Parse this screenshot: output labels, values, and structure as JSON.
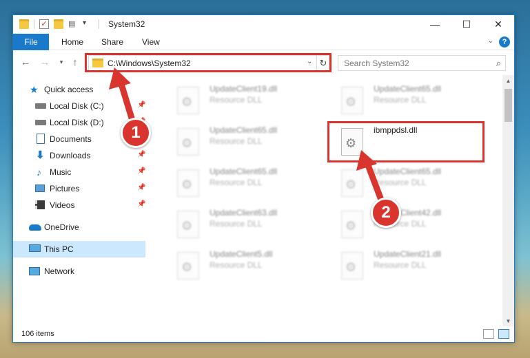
{
  "window": {
    "title": "System32",
    "controls": {
      "minimize": "—",
      "maximize": "☐",
      "close": "✕"
    }
  },
  "ribbon": {
    "file_tab": "File",
    "tabs": [
      "Home",
      "Share",
      "View"
    ],
    "help": "?"
  },
  "navigation": {
    "address": "C:\\Windows\\System32",
    "search_placeholder": "Search System32"
  },
  "sidebar": {
    "items": [
      {
        "label": "Quick access",
        "icon": "star-icon",
        "pinned": false
      },
      {
        "label": "Local Disk (C:)",
        "icon": "drive-icon",
        "pinned": true
      },
      {
        "label": "Local Disk (D:)",
        "icon": "drive-icon",
        "pinned": true
      },
      {
        "label": "Documents",
        "icon": "documents-icon",
        "pinned": true
      },
      {
        "label": "Downloads",
        "icon": "downloads-icon",
        "pinned": true
      },
      {
        "label": "Music",
        "icon": "music-icon",
        "pinned": true
      },
      {
        "label": "Pictures",
        "icon": "pictures-icon",
        "pinned": true
      },
      {
        "label": "Videos",
        "icon": "videos-icon",
        "pinned": true
      },
      {
        "label": "OneDrive",
        "icon": "onedrive-icon",
        "pinned": false
      },
      {
        "label": "This PC",
        "icon": "this-pc-icon",
        "pinned": false,
        "selected": true
      },
      {
        "label": "Network",
        "icon": "network-icon",
        "pinned": false
      }
    ]
  },
  "files": {
    "left_column": [
      {
        "name": "UpdateClient19.dll",
        "type": "Resource DLL"
      },
      {
        "name": "UpdateClient65.dll",
        "type": "Resource DLL"
      },
      {
        "name": "UpdateClient65.dll",
        "type": "Resource DLL"
      },
      {
        "name": "UpdateClient63.dll",
        "type": "Resource DLL"
      },
      {
        "name": "UpdateClient5.dll",
        "type": "Resource DLL"
      }
    ],
    "right_column": [
      {
        "name": "UpdateClient65.dll",
        "type": "Resource DLL"
      },
      {
        "name": "ibmppdsl.dll",
        "type": "",
        "highlighted": true
      },
      {
        "name": "UpdateClient65.dll",
        "type": "Resource DLL"
      },
      {
        "name": "UpdateClient42.dll",
        "type": "Resource DLL"
      },
      {
        "name": "UpdateClient21.dll",
        "type": "Resource DLL"
      }
    ]
  },
  "status": {
    "item_count": "106 items"
  },
  "callouts": {
    "step1": "1",
    "step2": "2",
    "color": "#d9352e"
  },
  "colors": {
    "accent": "#1979ca",
    "selection": "#cce8ff"
  }
}
